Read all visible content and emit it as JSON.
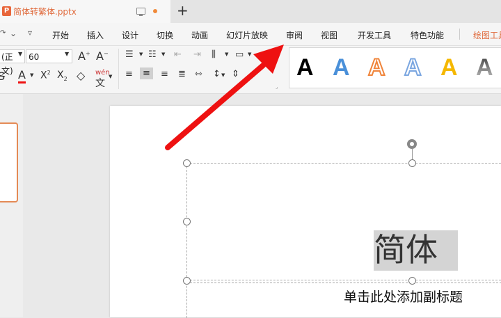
{
  "document": {
    "title": "简体转繁体.pptx",
    "icon_letter": "P"
  },
  "ribbon_tabs": [
    "开始",
    "插入",
    "设计",
    "切换",
    "动画",
    "幻灯片放映",
    "审阅",
    "视图",
    "开发工具",
    "特色功能",
    "绘图工具"
  ],
  "toolbar": {
    "font_name": "(正文)",
    "font_size": "60",
    "phonetic_label": "wén"
  },
  "wordart_styles": [
    {
      "letter": "A",
      "color": "#000000"
    },
    {
      "letter": "A",
      "color": "#4a90d9"
    },
    {
      "letter": "A",
      "color": "#f0843a"
    },
    {
      "letter": "A",
      "color": "#7aa6e0"
    },
    {
      "letter": "A",
      "color": "#f5b800"
    },
    {
      "letter": "A",
      "color": "#666666"
    }
  ],
  "slide": {
    "title_text": "简体",
    "subtitle_placeholder": "单击此处添加副标题"
  },
  "colors": {
    "accent": "#e06a3c",
    "annotation_arrow": "#ee1111"
  }
}
